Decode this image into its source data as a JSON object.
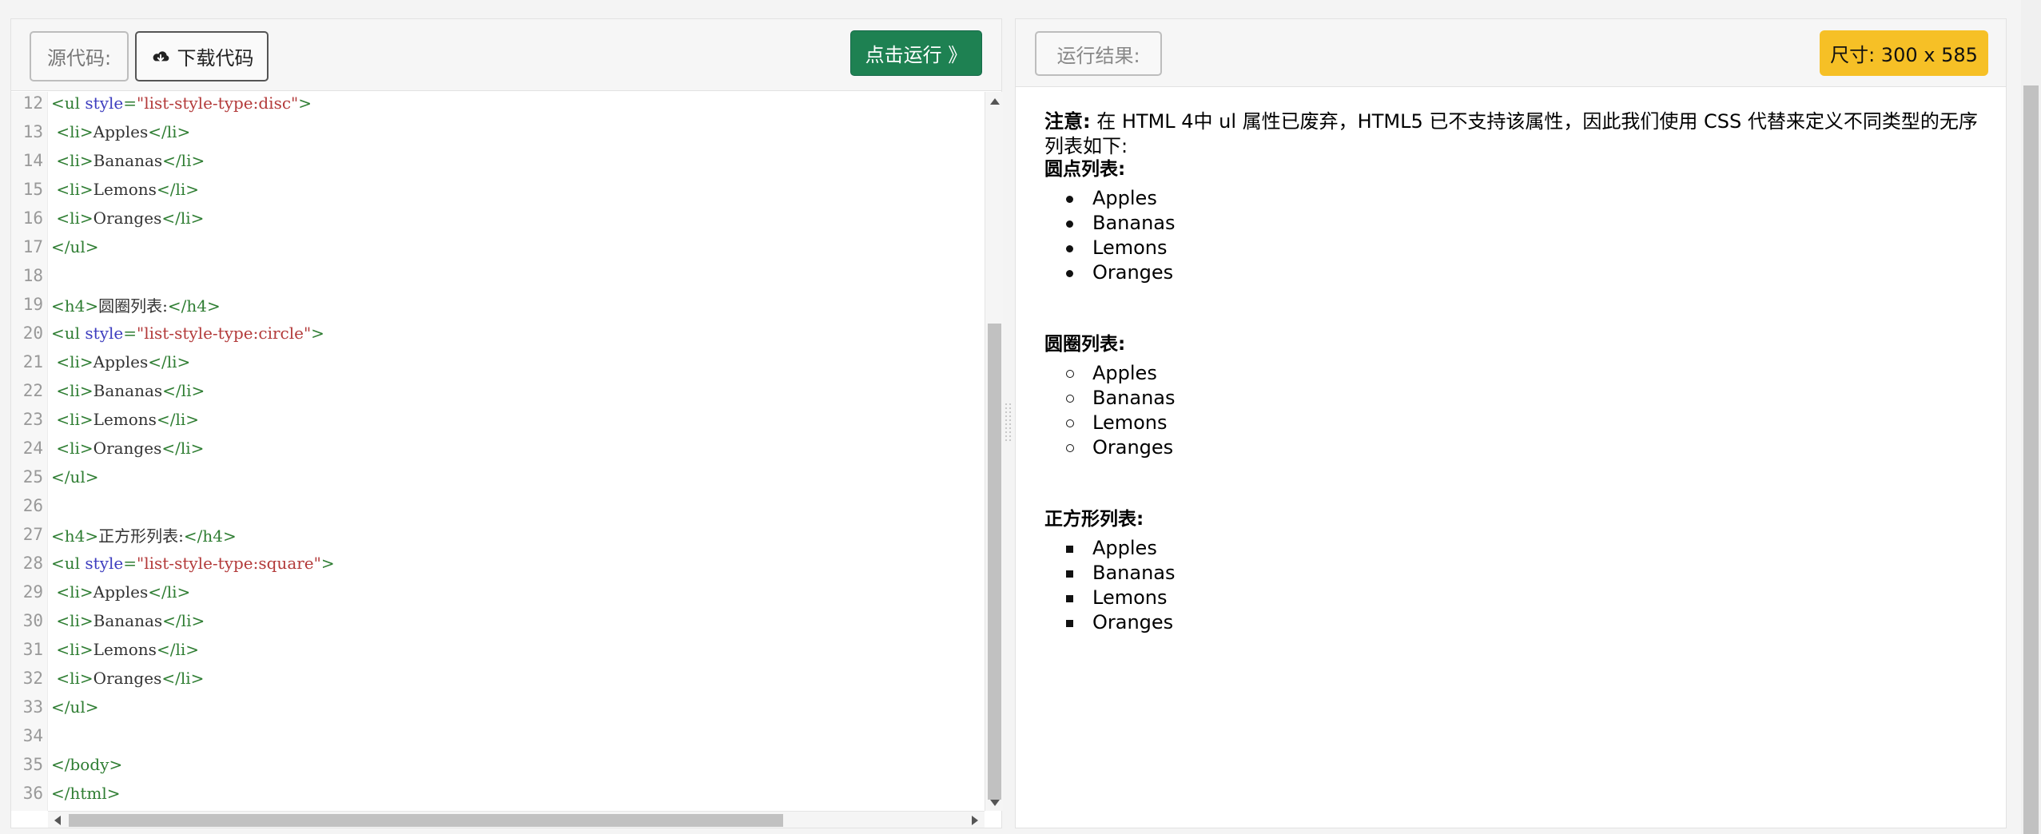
{
  "editor": {
    "source_label": "源代码:",
    "download_label": "下载代码",
    "run_label": "点击运行 》",
    "lines": [
      {
        "n": "12",
        "parts": [
          [
            "tag",
            "<ul "
          ],
          [
            "attr",
            "style"
          ],
          [
            "tag",
            "="
          ],
          [
            "str",
            "\"list-style-type:disc\""
          ],
          [
            "tag",
            ">"
          ]
        ]
      },
      {
        "n": "13",
        "parts": [
          [
            "tag",
            " <li>"
          ],
          [
            "txt",
            "Apples"
          ],
          [
            "tag",
            "</li>"
          ]
        ]
      },
      {
        "n": "14",
        "parts": [
          [
            "tag",
            " <li>"
          ],
          [
            "txt",
            "Bananas"
          ],
          [
            "tag",
            "</li>"
          ]
        ]
      },
      {
        "n": "15",
        "parts": [
          [
            "tag",
            " <li>"
          ],
          [
            "txt",
            "Lemons"
          ],
          [
            "tag",
            "</li>"
          ]
        ]
      },
      {
        "n": "16",
        "parts": [
          [
            "tag",
            " <li>"
          ],
          [
            "txt",
            "Oranges"
          ],
          [
            "tag",
            "</li>"
          ]
        ]
      },
      {
        "n": "17",
        "parts": [
          [
            "tag",
            "</ul>"
          ]
        ]
      },
      {
        "n": "18",
        "parts": []
      },
      {
        "n": "19",
        "parts": [
          [
            "tag",
            "<h4>"
          ],
          [
            "txt",
            "圆圈列表:"
          ],
          [
            "tag",
            "</h4>"
          ]
        ]
      },
      {
        "n": "20",
        "parts": [
          [
            "tag",
            "<ul "
          ],
          [
            "attr",
            "style"
          ],
          [
            "tag",
            "="
          ],
          [
            "str",
            "\"list-style-type:circle\""
          ],
          [
            "tag",
            ">"
          ]
        ]
      },
      {
        "n": "21",
        "parts": [
          [
            "tag",
            " <li>"
          ],
          [
            "txt",
            "Apples"
          ],
          [
            "tag",
            "</li>"
          ]
        ]
      },
      {
        "n": "22",
        "parts": [
          [
            "tag",
            " <li>"
          ],
          [
            "txt",
            "Bananas"
          ],
          [
            "tag",
            "</li>"
          ]
        ]
      },
      {
        "n": "23",
        "parts": [
          [
            "tag",
            " <li>"
          ],
          [
            "txt",
            "Lemons"
          ],
          [
            "tag",
            "</li>"
          ]
        ]
      },
      {
        "n": "24",
        "parts": [
          [
            "tag",
            " <li>"
          ],
          [
            "txt",
            "Oranges"
          ],
          [
            "tag",
            "</li>"
          ]
        ]
      },
      {
        "n": "25",
        "parts": [
          [
            "tag",
            "</ul>"
          ]
        ]
      },
      {
        "n": "26",
        "parts": []
      },
      {
        "n": "27",
        "parts": [
          [
            "tag",
            "<h4>"
          ],
          [
            "txt",
            "正方形列表:"
          ],
          [
            "tag",
            "</h4>"
          ]
        ]
      },
      {
        "n": "28",
        "parts": [
          [
            "tag",
            "<ul "
          ],
          [
            "attr",
            "style"
          ],
          [
            "tag",
            "="
          ],
          [
            "str",
            "\"list-style-type:square\""
          ],
          [
            "tag",
            ">"
          ]
        ]
      },
      {
        "n": "29",
        "parts": [
          [
            "tag",
            " <li>"
          ],
          [
            "txt",
            "Apples"
          ],
          [
            "tag",
            "</li>"
          ]
        ]
      },
      {
        "n": "30",
        "parts": [
          [
            "tag",
            " <li>"
          ],
          [
            "txt",
            "Bananas"
          ],
          [
            "tag",
            "</li>"
          ]
        ]
      },
      {
        "n": "31",
        "parts": [
          [
            "tag",
            " <li>"
          ],
          [
            "txt",
            "Lemons"
          ],
          [
            "tag",
            "</li>"
          ]
        ]
      },
      {
        "n": "32",
        "parts": [
          [
            "tag",
            " <li>"
          ],
          [
            "txt",
            "Oranges"
          ],
          [
            "tag",
            "</li>"
          ]
        ]
      },
      {
        "n": "33",
        "parts": [
          [
            "tag",
            "</ul>"
          ]
        ]
      },
      {
        "n": "34",
        "parts": []
      },
      {
        "n": "35",
        "parts": [
          [
            "tag",
            "</body>"
          ]
        ]
      },
      {
        "n": "36",
        "parts": [
          [
            "tag",
            "</html>"
          ]
        ]
      }
    ]
  },
  "result": {
    "label": "运行结果:",
    "size_badge": "尺寸: 300 x 585",
    "note_strong": "注意:",
    "note_text": "  在 HTML 4中 ul 属性已废弃，HTML5 已不支持该属性，因此我们使用 CSS 代替来定义不同类型的无序列表如下:",
    "sections": [
      {
        "heading": "圆点列表:",
        "marker": "disc",
        "items": [
          "Apples",
          "Bananas",
          "Lemons",
          "Oranges"
        ]
      },
      {
        "heading": "圆圈列表:",
        "marker": "circle",
        "items": [
          "Apples",
          "Bananas",
          "Lemons",
          "Oranges"
        ]
      },
      {
        "heading": "正方形列表:",
        "marker": "square",
        "items": [
          "Apples",
          "Bananas",
          "Lemons",
          "Oranges"
        ]
      }
    ]
  },
  "colors": {
    "run_button": "#1e8152",
    "size_badge": "#f6c026",
    "code_tag": "#2e7d32",
    "code_attr": "#3d3dbf",
    "code_string": "#b33a3a"
  }
}
